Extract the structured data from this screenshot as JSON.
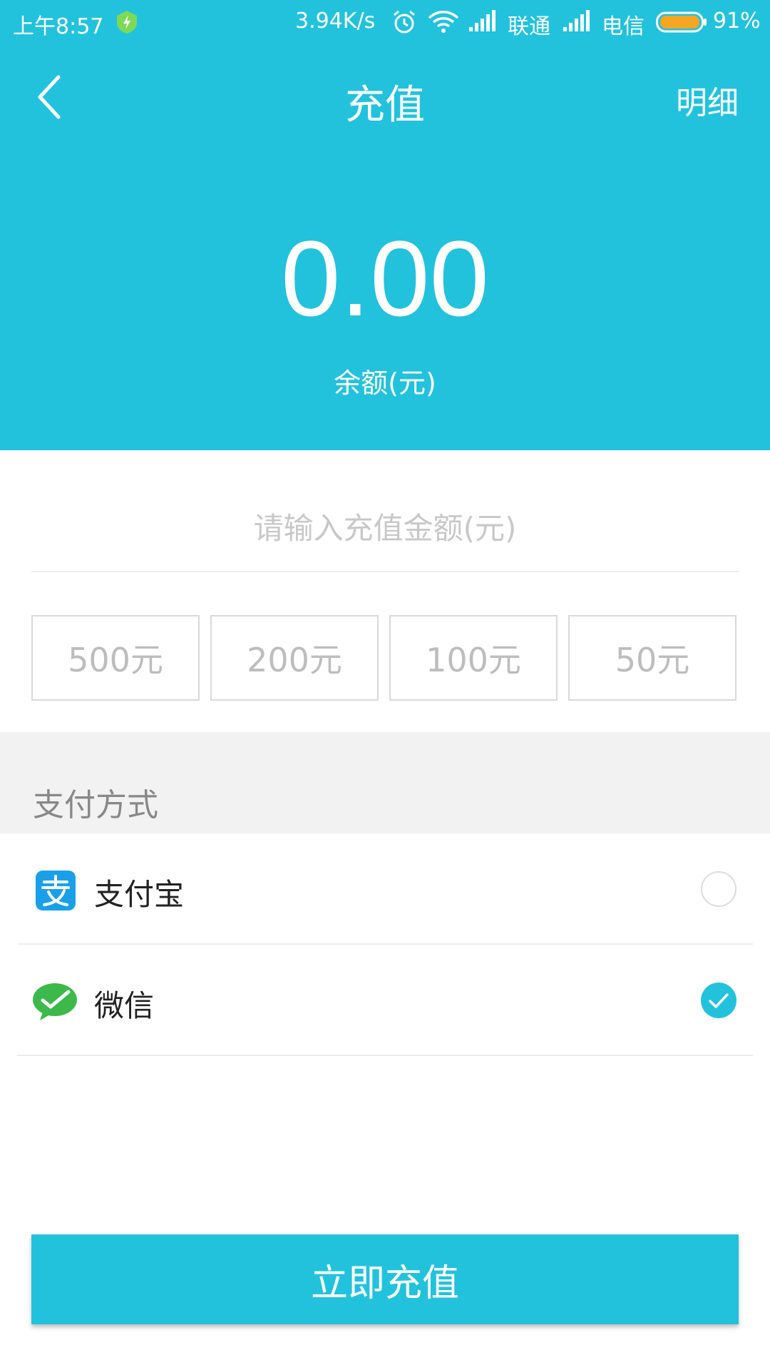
{
  "status_bar": {
    "time": "上午8:57",
    "net_speed": "3.94K/s",
    "carrier1": "联通",
    "carrier2": "电信",
    "battery": "91%",
    "icons": [
      "shield-icon",
      "alarm-icon",
      "wifi-icon",
      "signal-icon",
      "signal-icon",
      "battery-icon"
    ]
  },
  "nav": {
    "back_icon": "chevron-left-icon",
    "title": "充值",
    "detail": "明细"
  },
  "balance": {
    "amount": "0.00",
    "label": "余额(元)"
  },
  "recharge": {
    "value": "",
    "placeholder": "请输入充值金额(元)",
    "presets": [
      "500元",
      "200元",
      "100元",
      "50元"
    ]
  },
  "payment": {
    "heading": "支付方式",
    "methods": [
      {
        "label": "支付宝",
        "icon": "alipay-icon",
        "selected": false
      },
      {
        "label": "微信",
        "icon": "wechat-icon",
        "selected": true
      }
    ]
  },
  "submit_label": "立即充值",
  "colors": {
    "primary": "#22C2DC",
    "alipay": "#1AA0E8",
    "wechat": "#3CB94A",
    "battery": "#F5A623"
  }
}
